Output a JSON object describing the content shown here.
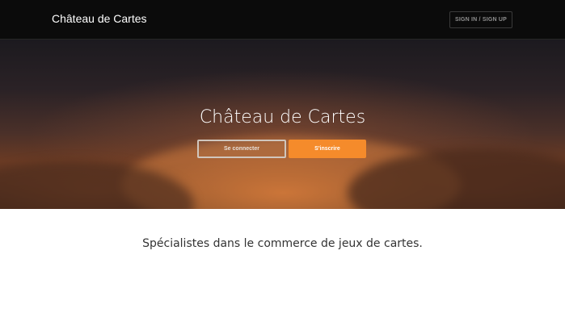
{
  "navbar": {
    "brand": "Château de Cartes",
    "signin_label": "SIGN IN / SIGN UP"
  },
  "hero": {
    "title": "Château de Cartes",
    "connect_label": "Se connecter",
    "signup_label": "S'inscrire",
    "accent_color": "#f58b2b"
  },
  "content": {
    "tagline": "Spécialistes dans le commerce de jeux de cartes."
  }
}
